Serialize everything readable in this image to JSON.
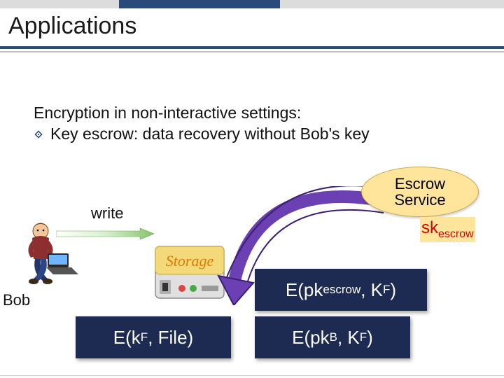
{
  "colors": {
    "header": "#294a7a",
    "storage_body": "#e0e0e0",
    "storage_text": "#e07a00",
    "escrow_fill": "#ffe49c",
    "darkbox": "#1d2a52",
    "sk_red": "#d80000",
    "arrow_purple": "#6a40b3"
  },
  "title": "Applications",
  "body": {
    "line1": "Encryption in non-interactive settings:",
    "line2": "Key escrow:  data recovery without Bob's key"
  },
  "write_label": "write",
  "bob_label": "Bob",
  "storage_label": "Storage",
  "escrow": {
    "title_line1": "Escrow",
    "title_line2": "Service",
    "sk_html": "sk<sub>escrow</sub>"
  },
  "boxes": {
    "a": "E(k<sub>F</sub>, File)",
    "b": "E(pk<sub>B</sub>, K<sub>F</sub>)",
    "c": "E(pk<sub>escrow</sub>, K<sub>F</sub>)"
  }
}
